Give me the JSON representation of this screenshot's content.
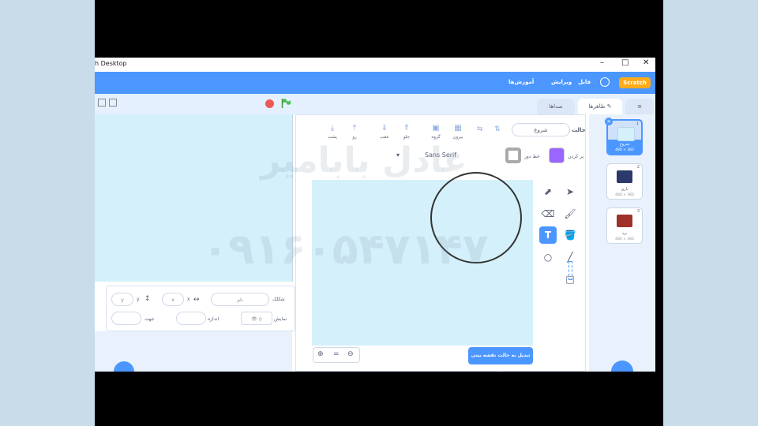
{
  "window": {
    "title": "h Desktop",
    "minimize": "–",
    "maximize": "□",
    "close": "✕"
  },
  "menubar": {
    "logo": "Scratch",
    "file": "فایل",
    "edit": "ویرایش",
    "tutorials": "آموزش‌ها"
  },
  "tabs": {
    "costumes": "ظاهرها",
    "sounds": "صداها"
  },
  "sprite_info": {
    "sprite_label": "شکلک",
    "name_placeholder": "نام",
    "x_label": "x",
    "y_label": "y",
    "x_value": "x",
    "y_value": "y",
    "show_label": "نمایش",
    "size_label": "اندازه",
    "direction_label": "جهت"
  },
  "editor": {
    "costume_label": "حالت",
    "costume_name": "شروع",
    "toolbar": [
      {
        "label": "بیرون",
        "icon": "ungroup-icon"
      },
      {
        "label": "گروه",
        "icon": "group-icon"
      },
      {
        "label": "جلو",
        "icon": "forward-icon"
      },
      {
        "label": "عقب",
        "icon": "backward-icon"
      },
      {
        "label": "رو",
        "icon": "front-icon"
      },
      {
        "label": "پشت",
        "icon": "back-icon"
      }
    ],
    "fill_label": "پر کردن",
    "outline_label": "خط دور",
    "font": "Sans Serif",
    "convert_button": "تبدیل به حالت نقشه بیتی"
  },
  "costumes": [
    {
      "num": "1",
      "name": "شروع",
      "size": "480 × 360",
      "color": "#d4f0fb"
    },
    {
      "num": "2",
      "name": "بازی",
      "size": "480 × 360",
      "color": "#2b3a6b"
    },
    {
      "num": "3",
      "name": "برد",
      "size": "480 × 360",
      "color": "#a0302a"
    }
  ],
  "watermark": {
    "line1": "عادل بابامیر",
    "line2": "۰۹۱۶۰۵۴۷۱۴۷"
  }
}
